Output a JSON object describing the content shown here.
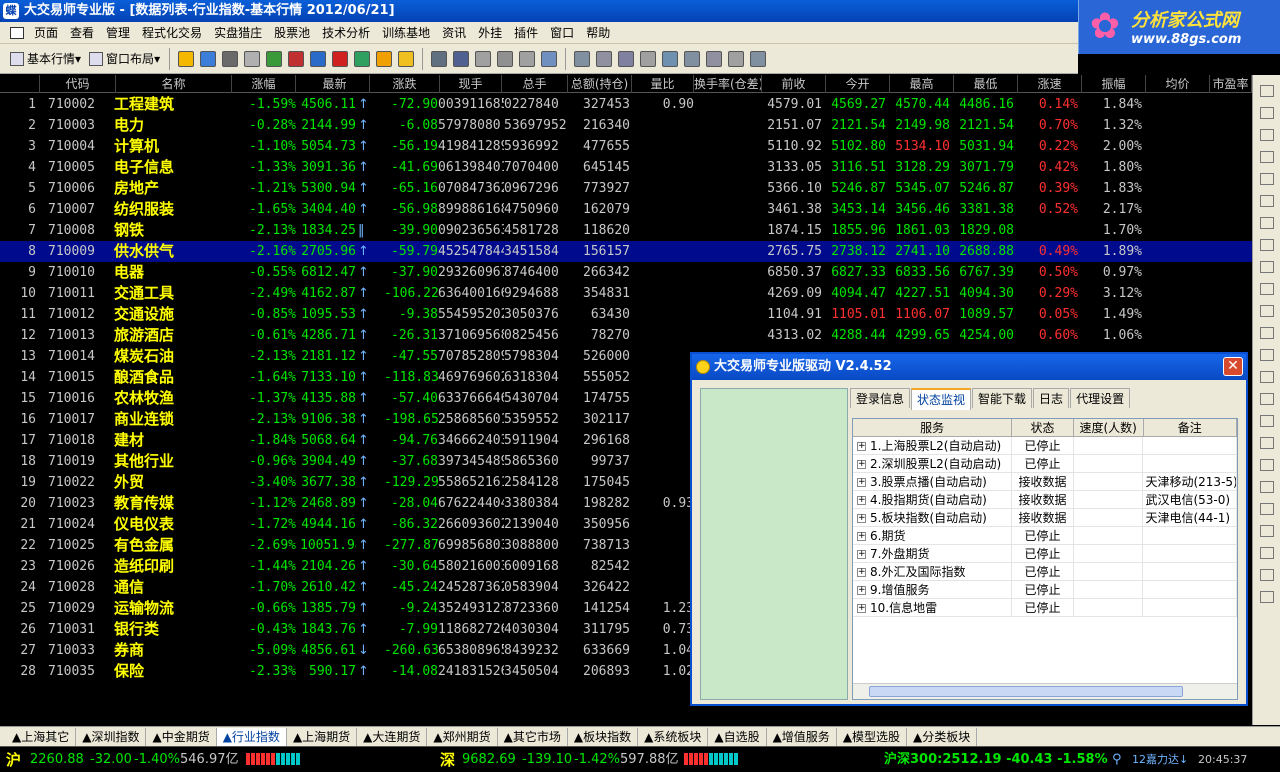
{
  "window": {
    "title": "大交易师专业版 - [数据列表-行业指数-基本行情 2012/06/21]",
    "app_icon": "蝶"
  },
  "logo": {
    "line1": "分析家公式网",
    "line2": "www.88gs.com"
  },
  "menu": [
    "页面",
    "查看",
    "管理",
    "程式化交易",
    "实盘猎庄",
    "股票池",
    "技术分析",
    "训练基地",
    "资讯",
    "外挂",
    "插件",
    "窗口",
    "帮助"
  ],
  "toolbar": {
    "quote_btn": "基本行情",
    "layout_btn": "窗口布局"
  },
  "columns": [
    "",
    "代码",
    "名称",
    "涨幅",
    "最新",
    "涨跌",
    "现手",
    "总手",
    "总额(持仓)",
    "量比",
    "换手率(仓差)",
    "前收",
    "今开",
    "最高",
    "最低",
    "涨速",
    "振幅",
    "均价",
    "市盈率"
  ],
  "rows": [
    {
      "idx": "1",
      "code": "710002",
      "name": "工程建筑",
      "pct": "-1.59%",
      "last": "4506.11",
      "arrow": "↑",
      "chg": "-72.90",
      "rest": "003911685",
      "total": "0227840",
      "amt": "327453",
      "ratio": "0.90",
      "prev": "4579.01",
      "open": "4569.27",
      "high": "4570.44",
      "low": "4486.16",
      "spd": "0.14%",
      "amp": "1.84%",
      "openc": "green",
      "highc": "green"
    },
    {
      "idx": "2",
      "code": "710003",
      "name": "电力",
      "pct": "-0.28%",
      "last": "2144.99",
      "arrow": "↑",
      "chg": "-6.08",
      "rest": "57978080",
      "total": "53697952",
      "amt": "216340",
      "ratio": "",
      "prev": "2151.07",
      "open": "2121.54",
      "high": "2149.98",
      "low": "2121.54",
      "spd": "0.70%",
      "amp": "1.32%",
      "openc": "green",
      "highc": "green"
    },
    {
      "idx": "3",
      "code": "710004",
      "name": "计算机",
      "pct": "-1.10%",
      "last": "5054.73",
      "arrow": "↑",
      "chg": "-56.19",
      "rest": "419841289",
      "total": "5936992",
      "amt": "477655",
      "ratio": "",
      "prev": "5110.92",
      "open": "5102.80",
      "high": "5134.10",
      "low": "5031.94",
      "spd": "0.22%",
      "amp": "2.00%",
      "openc": "green",
      "highc": "red"
    },
    {
      "idx": "4",
      "code": "710005",
      "name": "电子信息",
      "pct": "-1.33%",
      "last": "3091.36",
      "arrow": "↑",
      "chg": "-41.69",
      "rest": "061398401",
      "total": "7070400",
      "amt": "645145",
      "ratio": "",
      "prev": "3133.05",
      "open": "3116.51",
      "high": "3128.29",
      "low": "3071.79",
      "spd": "0.42%",
      "amp": "1.80%",
      "openc": "green",
      "highc": "green"
    },
    {
      "idx": "5",
      "code": "710006",
      "name": "房地产",
      "pct": "-1.21%",
      "last": "5300.94",
      "arrow": "↑",
      "chg": "-65.16",
      "rest": "070847362",
      "total": "0967296",
      "amt": "773927",
      "ratio": "",
      "prev": "5366.10",
      "open": "5246.87",
      "high": "5345.07",
      "low": "5246.87",
      "spd": "0.39%",
      "amp": "1.83%",
      "openc": "green",
      "highc": "green"
    },
    {
      "idx": "6",
      "code": "710007",
      "name": "纺织服装",
      "pct": "-1.65%",
      "last": "3404.40",
      "arrow": "↑",
      "chg": "-56.98",
      "rest": "899886168",
      "total": "4750960",
      "amt": "162079",
      "ratio": "",
      "prev": "3461.38",
      "open": "3453.14",
      "high": "3456.46",
      "low": "3381.38",
      "spd": "0.52%",
      "amp": "2.17%",
      "openc": "green",
      "highc": "green"
    },
    {
      "idx": "7",
      "code": "710008",
      "name": "钢铁",
      "pct": "-2.13%",
      "last": "1834.25",
      "arrow": "‖",
      "chg": "-39.90",
      "rest": "090236563",
      "total": "4581728",
      "amt": "118620",
      "ratio": "",
      "prev": "1874.15",
      "open": "1855.96",
      "high": "1861.03",
      "low": "1829.08",
      "spd": "",
      "amp": "1.70%",
      "openc": "green",
      "highc": "green"
    },
    {
      "idx": "8",
      "code": "710009",
      "name": "供水供气",
      "pct": "-2.16%",
      "last": "2705.96",
      "arrow": "↑",
      "chg": "-59.79",
      "rest": "452547844",
      "total": "3451584",
      "amt": "156157",
      "ratio": "",
      "prev": "2765.75",
      "open": "2738.12",
      "high": "2741.10",
      "low": "2688.88",
      "spd": "0.49%",
      "amp": "1.89%",
      "openc": "green",
      "highc": "green"
    },
    {
      "idx": "9",
      "code": "710010",
      "name": "电器",
      "pct": "-0.55%",
      "last": "6812.47",
      "arrow": "↑",
      "chg": "-37.90",
      "rest": "293260967",
      "total": "8746400",
      "amt": "266342",
      "ratio": "",
      "prev": "6850.37",
      "open": "6827.33",
      "high": "6833.56",
      "low": "6767.39",
      "spd": "0.50%",
      "amp": "0.97%",
      "openc": "green",
      "highc": "green"
    },
    {
      "idx": "10",
      "code": "710011",
      "name": "交通工具",
      "pct": "-2.49%",
      "last": "4162.87",
      "arrow": "↑",
      "chg": "-106.22",
      "rest": "636400166",
      "total": "9294688",
      "amt": "354831",
      "ratio": "",
      "prev": "4269.09",
      "open": "4094.47",
      "high": "4227.51",
      "low": "4094.30",
      "spd": "0.29%",
      "amp": "3.12%",
      "openc": "green",
      "highc": "green"
    },
    {
      "idx": "11",
      "code": "710012",
      "name": "交通设施",
      "pct": "-0.85%",
      "last": "1095.53",
      "arrow": "↑",
      "chg": "-9.38",
      "rest": "554595202",
      "total": "3050376",
      "amt": "63430",
      "ratio": "",
      "prev": "1104.91",
      "open": "1105.01",
      "high": "1106.07",
      "low": "1089.57",
      "spd": "0.05%",
      "amp": "1.49%",
      "openc": "red",
      "highc": "red"
    },
    {
      "idx": "12",
      "code": "710013",
      "name": "旅游酒店",
      "pct": "-0.61%",
      "last": "4286.71",
      "arrow": "↑",
      "chg": "-26.31",
      "rest": "371069568",
      "total": "0825456",
      "amt": "78270",
      "ratio": "",
      "prev": "4313.02",
      "open": "4288.44",
      "high": "4299.65",
      "low": "4254.00",
      "spd": "0.60%",
      "amp": "1.06%",
      "openc": "green",
      "highc": "green"
    },
    {
      "idx": "13",
      "code": "710014",
      "name": "煤炭石油",
      "pct": "-2.13%",
      "last": "2181.12",
      "arrow": "↑",
      "chg": "-47.55",
      "rest": "707852809",
      "total": "5798304",
      "amt": "526000",
      "ratio": "",
      "prev": "",
      "open": "",
      "high": "",
      "low": "",
      "spd": "",
      "amp": "",
      "openc": "green",
      "highc": "green"
    },
    {
      "idx": "14",
      "code": "710015",
      "name": "酿酒食品",
      "pct": "-1.64%",
      "last": "7133.10",
      "arrow": "↑",
      "chg": "-118.83",
      "rest": "469769602",
      "total": "6318304",
      "amt": "555052",
      "ratio": "",
      "prev": "",
      "open": "",
      "high": "",
      "low": "",
      "spd": "",
      "amp": "",
      "openc": "green",
      "highc": "green"
    },
    {
      "idx": "15",
      "code": "710016",
      "name": "农林牧渔",
      "pct": "-1.37%",
      "last": "4135.88",
      "arrow": "↑",
      "chg": "-57.40",
      "rest": "633766646",
      "total": "5430704",
      "amt": "174755",
      "ratio": "",
      "prev": "",
      "open": "",
      "high": "",
      "low": "",
      "spd": "",
      "amp": "",
      "openc": "green",
      "highc": "green"
    },
    {
      "idx": "16",
      "code": "710017",
      "name": "商业连锁",
      "pct": "-2.13%",
      "last": "9106.38",
      "arrow": "↑",
      "chg": "-198.65",
      "rest": "258685601",
      "total": "5359552",
      "amt": "302117",
      "ratio": "",
      "prev": "",
      "open": "",
      "high": "",
      "low": "",
      "spd": "",
      "amp": "",
      "openc": "green",
      "highc": "green"
    },
    {
      "idx": "17",
      "code": "710018",
      "name": "建材",
      "pct": "-1.84%",
      "last": "5068.64",
      "arrow": "↑",
      "chg": "-94.76",
      "rest": "346662403",
      "total": "5911904",
      "amt": "296168",
      "ratio": "",
      "prev": "",
      "open": "",
      "high": "",
      "low": "",
      "spd": "",
      "amp": "",
      "openc": "green",
      "highc": "green"
    },
    {
      "idx": "18",
      "code": "710019",
      "name": "其他行业",
      "pct": "-0.96%",
      "last": "3904.49",
      "arrow": "↑",
      "chg": "-37.68",
      "rest": "397345489",
      "total": "5865360",
      "amt": "99737",
      "ratio": "",
      "prev": "",
      "open": "",
      "high": "",
      "low": "",
      "spd": "",
      "amp": "",
      "openc": "green",
      "highc": "green"
    },
    {
      "idx": "19",
      "code": "710022",
      "name": "外贸",
      "pct": "-3.40%",
      "last": "3677.38",
      "arrow": "↑",
      "chg": "-129.29",
      "rest": "558652161",
      "total": "2584128",
      "amt": "175045",
      "ratio": "",
      "prev": "",
      "open": "",
      "high": "",
      "low": "",
      "spd": "",
      "amp": "",
      "openc": "green",
      "highc": "green"
    },
    {
      "idx": "20",
      "code": "710023",
      "name": "教育传媒",
      "pct": "-1.12%",
      "last": "2468.89",
      "arrow": "↑",
      "chg": "-28.04",
      "rest": "676224404",
      "total": "3380384",
      "amt": "198282",
      "ratio": "0.93",
      "prev": "",
      "open": "",
      "high": "",
      "low": "",
      "spd": "",
      "amp": "",
      "openc": "green",
      "highc": "green"
    },
    {
      "idx": "21",
      "code": "710024",
      "name": "仪电仪表",
      "pct": "-1.72%",
      "last": "4944.16",
      "arrow": "↑",
      "chg": "-86.32",
      "rest": "266093602",
      "total": "2139040",
      "amt": "350956",
      "ratio": "",
      "prev": "",
      "open": "",
      "high": "",
      "low": "",
      "spd": "",
      "amp": "",
      "openc": "green",
      "highc": "green"
    },
    {
      "idx": "22",
      "code": "710025",
      "name": "有色金属",
      "pct": "-2.69%",
      "last": "10051.98",
      "arrow": "↑",
      "chg": "-277.87",
      "rest": "699856803",
      "total": "3088800",
      "amt": "738713",
      "ratio": "",
      "prev": "",
      "open": "",
      "high": "",
      "low": "",
      "spd": "",
      "amp": "",
      "openc": "green",
      "highc": "green"
    },
    {
      "idx": "23",
      "code": "710026",
      "name": "造纸印刷",
      "pct": "-1.44%",
      "last": "2104.26",
      "arrow": "↑",
      "chg": "-30.64",
      "rest": "580216003",
      "total": "6009168",
      "amt": "82542",
      "ratio": "",
      "prev": "",
      "open": "",
      "high": "",
      "low": "",
      "spd": "",
      "amp": "",
      "openc": "green",
      "highc": "green"
    },
    {
      "idx": "24",
      "code": "710028",
      "name": "通信",
      "pct": "-1.70%",
      "last": "2610.42",
      "arrow": "↑",
      "chg": "-45.24",
      "rest": "245287362",
      "total": "0583904",
      "amt": "326422",
      "ratio": "",
      "prev": "",
      "open": "",
      "high": "",
      "low": "",
      "spd": "",
      "amp": "",
      "openc": "green",
      "highc": "green"
    },
    {
      "idx": "25",
      "code": "710029",
      "name": "运输物流",
      "pct": "-0.66%",
      "last": "1385.79",
      "arrow": "↑",
      "chg": "-9.24",
      "rest": "352493127",
      "total": "8723360",
      "amt": "141254",
      "ratio": "1.23",
      "prev": "",
      "open": "",
      "high": "",
      "low": "",
      "spd": "",
      "amp": "",
      "openc": "green",
      "highc": "green"
    },
    {
      "idx": "26",
      "code": "710031",
      "name": "银行类",
      "pct": "-0.43%",
      "last": "1843.76",
      "arrow": "↑",
      "chg": "-7.99",
      "rest": "118682726",
      "total": "4030304",
      "amt": "311795",
      "ratio": "0.73",
      "prev": "",
      "open": "",
      "high": "",
      "low": "",
      "spd": "",
      "amp": "",
      "openc": "green",
      "highc": "green"
    },
    {
      "idx": "27",
      "code": "710033",
      "name": "券商",
      "pct": "-5.09%",
      "last": "4856.61",
      "arrow": "↓",
      "chg": "-260.63",
      "rest": "653808965",
      "total": "8439232",
      "amt": "633669",
      "ratio": "1.04",
      "prev": "",
      "open": "",
      "high": "",
      "low": "",
      "spd": "",
      "amp": "",
      "openc": "green",
      "highc": "green"
    },
    {
      "idx": "28",
      "code": "710035",
      "name": "保险",
      "pct": "-2.33%",
      "last": "590.17",
      "arrow": "↑",
      "chg": "-14.08",
      "rest": "241831526",
      "total": "3450504",
      "amt": "206893",
      "ratio": "1.02",
      "prev": "",
      "open": "",
      "high": "",
      "low": "",
      "spd": "",
      "amp": "",
      "openc": "green",
      "highc": "green"
    }
  ],
  "selected_row": "8",
  "dialog": {
    "title": "大交易师专业版驱动 V2.4.52",
    "close": "✕",
    "tabs": [
      "登录信息",
      "状态监视",
      "智能下载",
      "日志",
      "代理设置"
    ],
    "active_tab": "状态监视",
    "headers": [
      "服务",
      "状态",
      "速度(人数)",
      "备注"
    ],
    "services": [
      {
        "name": "1.上海股票L2(自动启动)",
        "status": "已停止",
        "speed": "",
        "remark": ""
      },
      {
        "name": "2.深圳股票L2(自动启动)",
        "status": "已停止",
        "speed": "",
        "remark": ""
      },
      {
        "name": "3.股票点播(自动启动)",
        "status": "接收数据",
        "speed": "",
        "remark": "天津移动(213-5)"
      },
      {
        "name": "4.股指期货(自动启动)",
        "status": "接收数据",
        "speed": "",
        "remark": "武汉电信(53-0)"
      },
      {
        "name": "5.板块指数(自动启动)",
        "status": "接收数据",
        "speed": "",
        "remark": "天津电信(44-1)"
      },
      {
        "name": "6.期货",
        "status": "已停止",
        "speed": "",
        "remark": ""
      },
      {
        "name": "7.外盘期货",
        "status": "已停止",
        "speed": "",
        "remark": ""
      },
      {
        "name": "8.外汇及国际指数",
        "status": "已停止",
        "speed": "",
        "remark": ""
      },
      {
        "name": "9.增值服务",
        "status": "已停止",
        "speed": "",
        "remark": ""
      },
      {
        "name": "10.信息地雷",
        "status": "已停止",
        "speed": "",
        "remark": ""
      }
    ]
  },
  "bottom_tabs": [
    "▲上海其它",
    "▲深圳指数",
    "▲中金期货",
    "▲行业指数",
    "▲上海期货",
    "▲大连期货",
    "▲郑州期货",
    "▲其它市场",
    "▲板块指数",
    "▲系统板块",
    "▲自选股",
    "▲增值服务",
    "▲模型选股",
    "▲分类板块"
  ],
  "active_bottom_tab": "▲行业指数",
  "status": {
    "sh_label": "沪",
    "sh_value": "2260.88",
    "sh_chg": "-32.00",
    "sh_pct": "-1.40%",
    "sh_amt": "546.97亿",
    "sz_label": "深",
    "sz_value": "9682.69",
    "sz_chg": "-139.10",
    "sz_pct": "-1.42%",
    "sz_amt": "597.88亿",
    "hs300": "沪深300:2512.19 -40.43 -1.58%",
    "tip": "12嘉力达↓",
    "time": "20:45:37"
  },
  "colors": {
    "up": "#ff3030",
    "down": "#00e600",
    "name": "#ffff00",
    "selected": "#000a8c"
  }
}
